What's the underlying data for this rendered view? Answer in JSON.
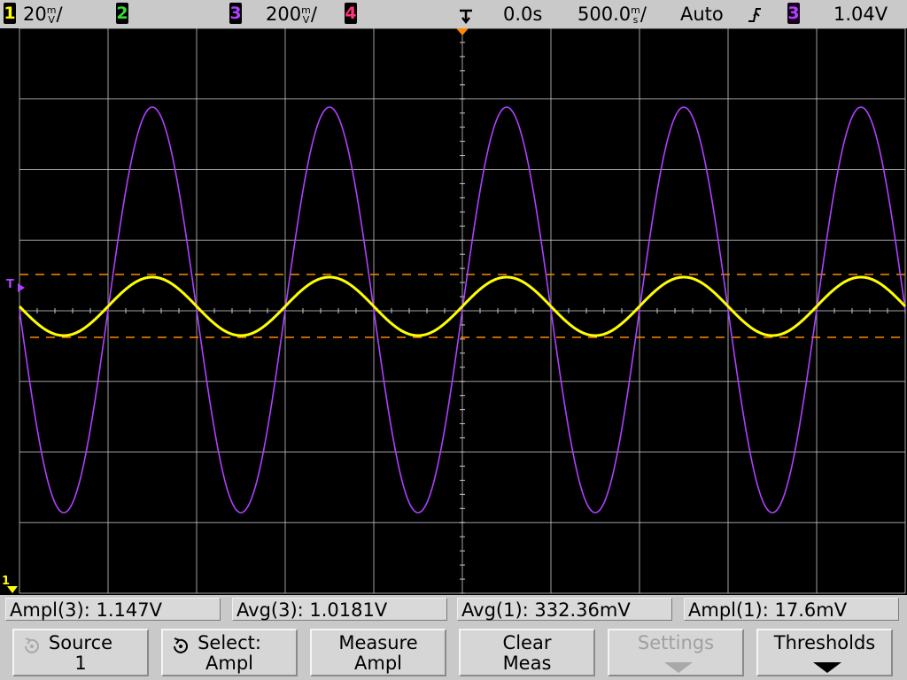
{
  "topbar": {
    "ch1": {
      "num": "1",
      "scale": "20",
      "unit_top": "m",
      "unit_bottom": "V",
      "suffix": "/",
      "color": "#ffff00"
    },
    "ch2": {
      "num": "2",
      "color": "#33dd33"
    },
    "ch3": {
      "num": "3",
      "scale": "200",
      "unit_top": "m",
      "unit_bottom": "V",
      "suffix": "/",
      "color": "#b040ff"
    },
    "ch4": {
      "num": "4",
      "color": "#ff3377"
    },
    "time_ref_icon": "trigger-time-reference-icon",
    "time_offset": "0.0s",
    "time_scale": "500.0",
    "time_unit_top": "m",
    "time_unit_bottom": "s",
    "time_suffix": "/",
    "trigger_mode": "Auto",
    "trigger_slope_icon": "rising-edge-icon",
    "trigger_source": "3",
    "trigger_level": "1.04V"
  },
  "screen": {
    "trigger_marker": "T",
    "ch1_ground_marker": "1",
    "colors": {
      "grid": "#c8c8c8",
      "ch1": "#ffff00",
      "ch3": "#b040ff",
      "cursor": "#ff8800"
    }
  },
  "measurements": [
    {
      "label": "Ampl(3): 1.147V"
    },
    {
      "label": "Avg(3): 1.0181V"
    },
    {
      "label": "Avg(1): 332.36mV"
    },
    {
      "label": "Ampl(1): 17.6mV"
    }
  ],
  "softkeys": [
    {
      "line1": "Source",
      "line2": "1",
      "icon": "rotate-knob-icon",
      "disabled": true
    },
    {
      "line1": "Select:",
      "line2": "Ampl",
      "icon": "rotate-knob-icon",
      "disabled": false
    },
    {
      "line1": "Measure",
      "line2": "Ampl",
      "disabled": false
    },
    {
      "line1": "Clear",
      "line2": "Meas",
      "disabled": false
    },
    {
      "line1": "Settings",
      "line2": "",
      "icon": "submenu-arrow-icon",
      "disabled": true
    },
    {
      "line1": "Thresholds",
      "line2": "",
      "icon": "submenu-arrow-icon",
      "disabled": false
    }
  ]
}
